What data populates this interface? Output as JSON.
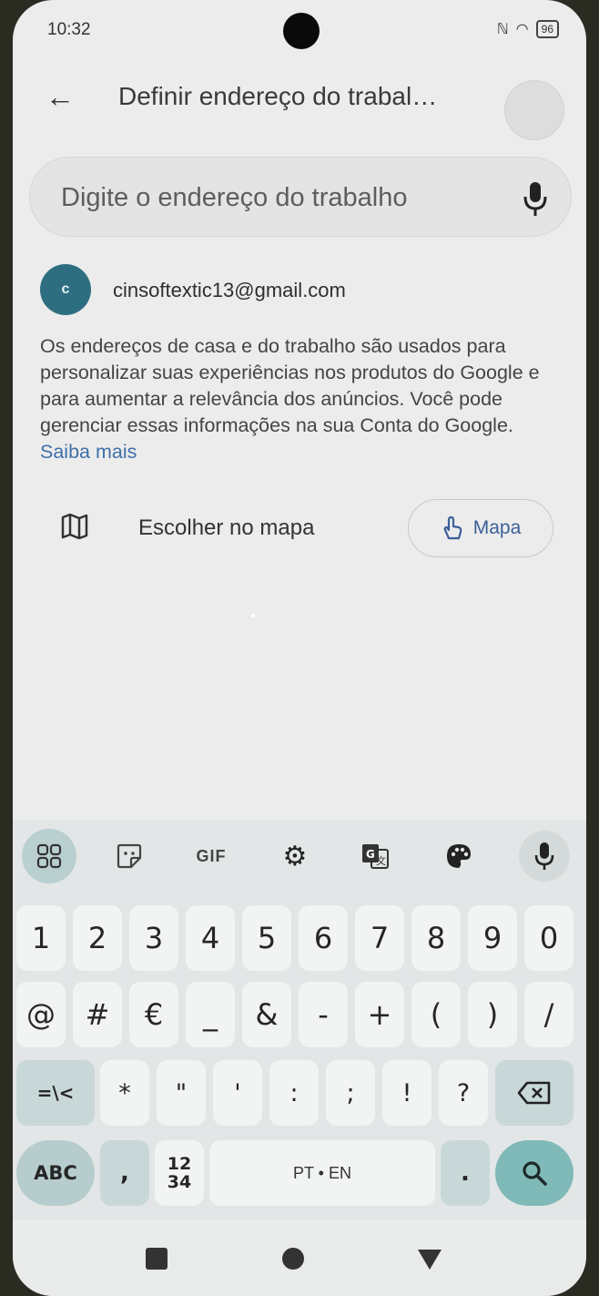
{
  "status_bar": {
    "time": "10:32",
    "battery": "96"
  },
  "header": {
    "title": "Definir endereço do trabal…"
  },
  "search": {
    "placeholder": "Digite o endereço do trabalho"
  },
  "account": {
    "avatar_letter": "c",
    "email": "cinsoftextic13@gmail.com"
  },
  "info": {
    "text": "Os endereços de casa e do trabalho são usados para personalizar suas experiências nos produtos do Google e para aumentar a relevância dos anúncios. Você pode gerenciar essas informações na sua Conta do Google.",
    "link": "Saiba mais"
  },
  "map_row": {
    "label": "Escolher no mapa",
    "button_label": "Mapa"
  },
  "keyboard": {
    "toolbar": {
      "gif_label": "GIF"
    },
    "row1": [
      "1",
      "2",
      "3",
      "4",
      "5",
      "6",
      "7",
      "8",
      "9",
      "0"
    ],
    "row2": [
      "@",
      "#",
      "€",
      "_",
      "&",
      "-",
      "+",
      "(",
      ")",
      "/"
    ],
    "row3": [
      "*",
      "\"",
      "'",
      ":",
      ";",
      "!",
      "?"
    ],
    "row3_shift": "=\\<",
    "abc_label": "ABC",
    "comma": ",",
    "num_toggle_top": "12",
    "num_toggle_bottom": "34",
    "space_label": "PT • EN",
    "period": "."
  },
  "icons": {
    "back": "arrow-left-icon",
    "mic": "microphone-icon",
    "map": "map-icon",
    "touch": "touch-hand-icon",
    "apps": "apps-grid-icon",
    "sticker": "sticker-icon",
    "settings": "gear-icon",
    "translate": "translate-icon",
    "theme": "palette-icon",
    "backspace": "backspace-icon",
    "search": "search-icon",
    "recents": "square-icon",
    "home": "circle-icon",
    "back_nav": "triangle-down-icon"
  },
  "colors": {
    "accent": "#3d6fa8",
    "avatar": "#2d6f80",
    "search_key": "#7fb9b8"
  }
}
